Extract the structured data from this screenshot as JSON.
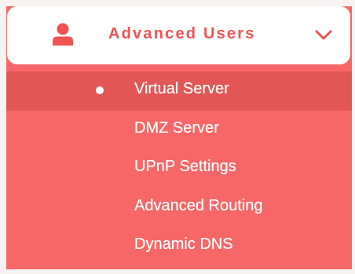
{
  "menu": {
    "header": {
      "label": "Advanced Users",
      "icon": "user-icon",
      "expand_icon": "chevron-down-icon"
    },
    "items": [
      {
        "label": "Virtual Server",
        "active": true
      },
      {
        "label": "DMZ Server",
        "active": false
      },
      {
        "label": "UPnP Settings",
        "active": false
      },
      {
        "label": "Advanced Routing",
        "active": false
      },
      {
        "label": "Dynamic DNS",
        "active": false
      }
    ]
  },
  "colors": {
    "menu_background": "#f86767",
    "active_item_background": "#e35656",
    "header_background": "#ffffff",
    "accent": "#f05252",
    "item_text": "#ffffff"
  }
}
